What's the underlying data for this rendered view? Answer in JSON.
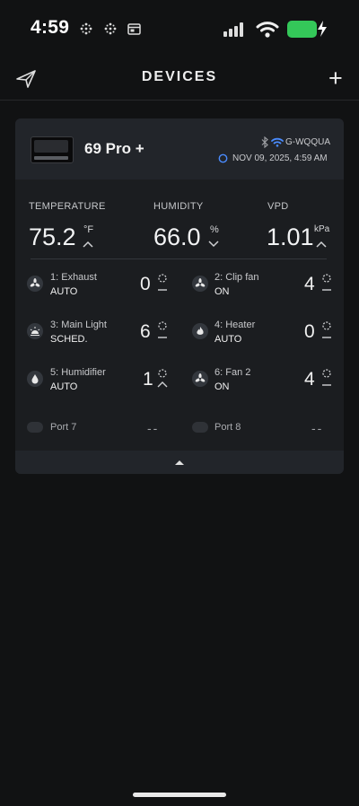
{
  "status_bar": {
    "time": "4:59",
    "icons": [
      "grid-icon",
      "grid-icon",
      "calendar-icon"
    ],
    "battery_color": "#34c759"
  },
  "header": {
    "title": "DEVICES",
    "add_label": "+"
  },
  "device": {
    "name": "69 Pro +",
    "network": "G-WQQUA",
    "timestamp": "NOV 09, 2025, 4:59 AM",
    "accent_wifi": "#4a8cff"
  },
  "readings": {
    "temperature": {
      "label": "TEMPERATURE",
      "value": "75.2",
      "unit": "°F"
    },
    "humidity": {
      "label": "HUMIDITY",
      "value": "66.0",
      "unit": "%"
    },
    "vpd": {
      "label": "VPD",
      "value": "1.01",
      "unit": "kPa"
    }
  },
  "ports": [
    {
      "name": "1: Exhaust",
      "mode": "AUTO",
      "level": "0",
      "icon": "fan-icon"
    },
    {
      "name": "2: Clip fan",
      "mode": "ON",
      "level": "4",
      "icon": "fan-icon"
    },
    {
      "name": "3: Main Light",
      "mode": "SCHED.",
      "level": "6",
      "icon": "light-icon"
    },
    {
      "name": "4: Heater",
      "mode": "AUTO",
      "level": "0",
      "icon": "flame-icon"
    },
    {
      "name": "5: Humidifier",
      "mode": "AUTO",
      "level": "1",
      "icon": "droplet-icon"
    },
    {
      "name": "6: Fan 2",
      "mode": "ON",
      "level": "4",
      "icon": "fan-icon"
    },
    {
      "name": "Port 7",
      "mode": "",
      "level": "--",
      "icon": "empty-port-icon"
    },
    {
      "name": "Port 8",
      "mode": "",
      "level": "--",
      "icon": "empty-port-icon"
    }
  ]
}
